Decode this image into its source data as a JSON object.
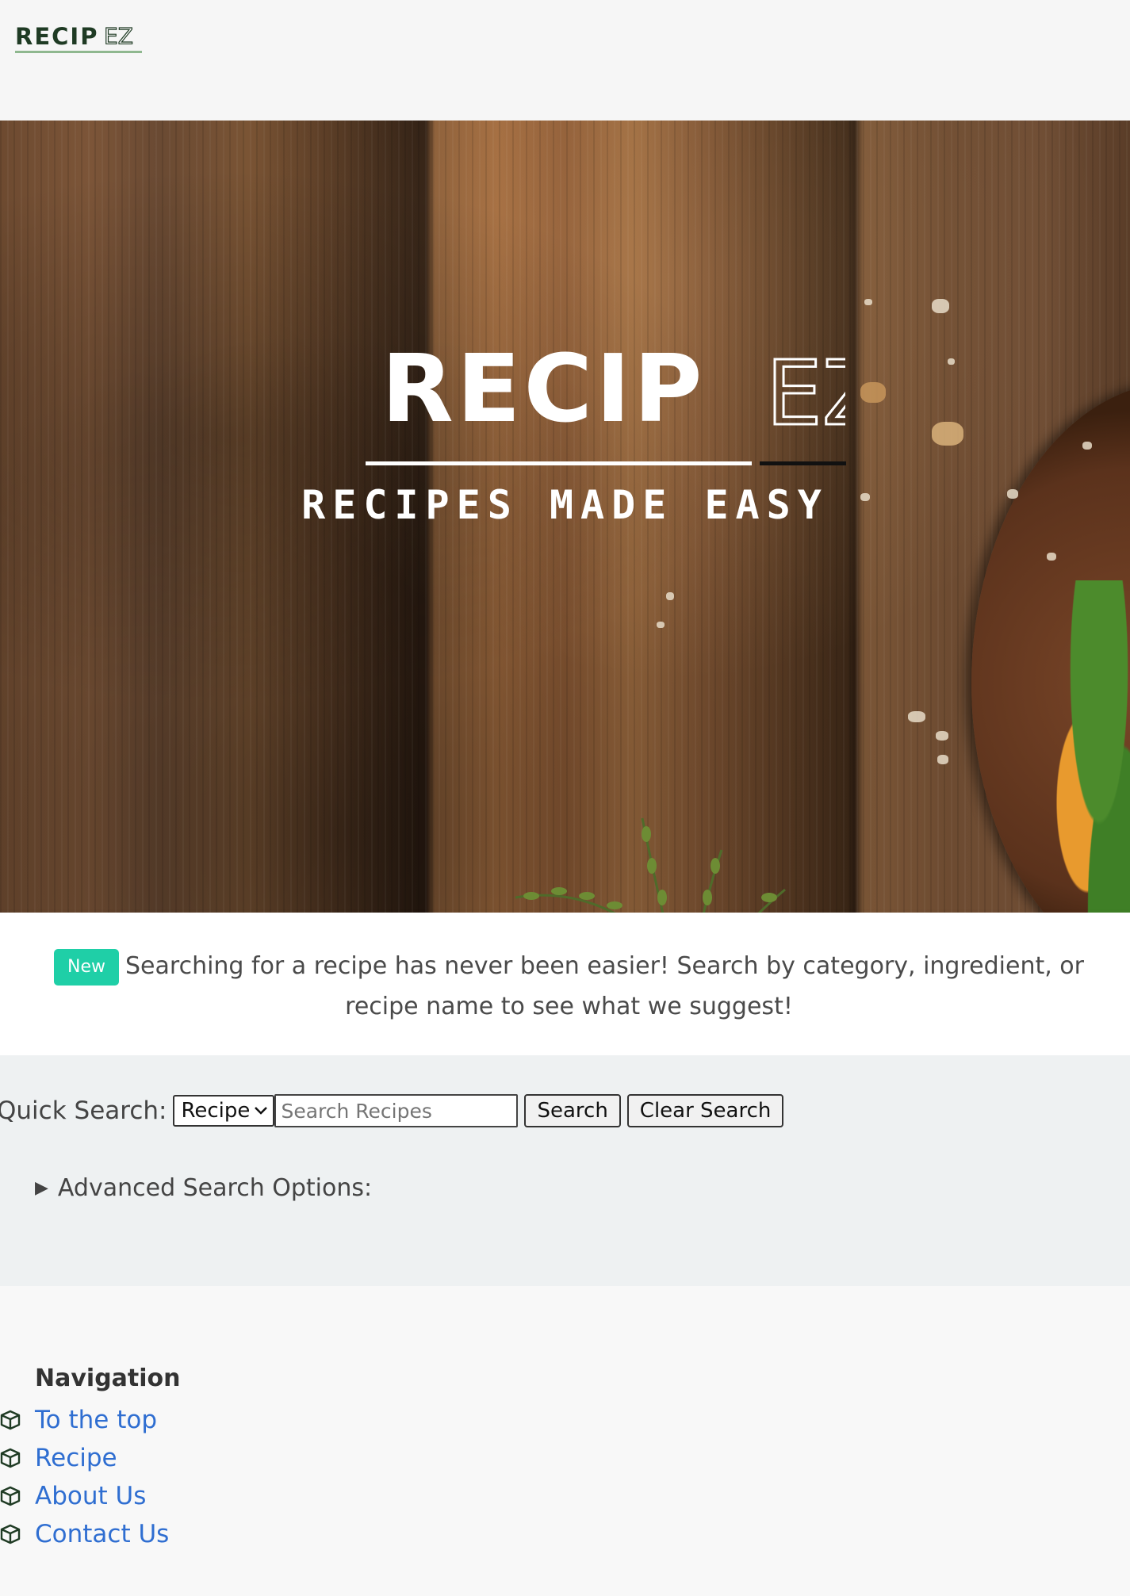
{
  "header": {
    "logo_text": "RECIP",
    "logo_suffix": "EZ"
  },
  "hero": {
    "title": "RECIP",
    "title_suffix": "EZ",
    "subtitle": "RECIPES MADE EASY"
  },
  "announcement": {
    "badge": "New",
    "text": "Searching for a recipe has never been easier! Search by category, ingredient, or recipe name to see what we suggest!"
  },
  "search": {
    "label": "Quick Search:",
    "category_selected": "Recipe",
    "input_placeholder": "Search Recipes",
    "search_button": "Search",
    "clear_button": "Clear Search",
    "advanced_label": "Advanced Search Options:"
  },
  "footer": {
    "nav_title": "Navigation",
    "links": [
      {
        "label": "To the top",
        "icon": "cube-icon"
      },
      {
        "label": "Recipe",
        "icon": "cube-icon"
      },
      {
        "label": "About Us",
        "icon": "cube-icon"
      },
      {
        "label": "Contact Us",
        "icon": "cube-icon"
      }
    ]
  },
  "colors": {
    "brand_dark": "#1f3b24",
    "badge": "#1fcfa7",
    "link": "#2f6ed1"
  }
}
